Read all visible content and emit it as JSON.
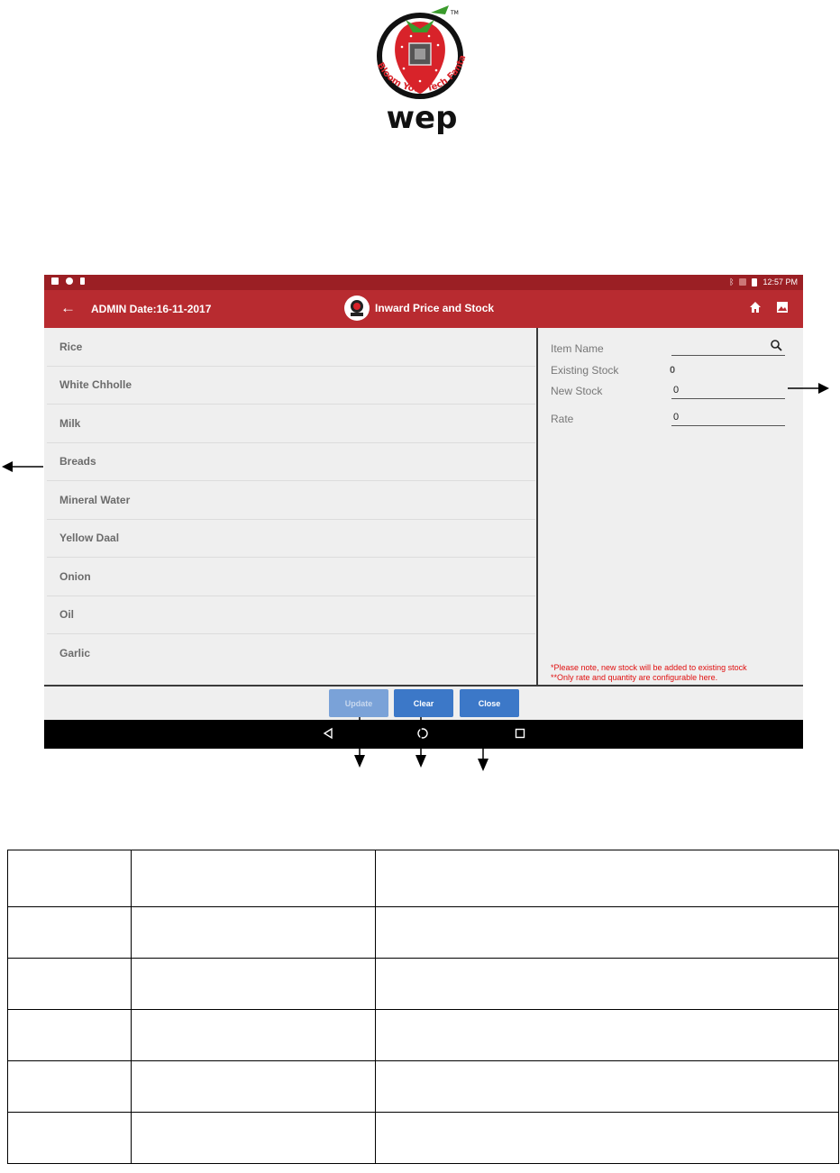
{
  "logo": {
    "trademark": "TM",
    "slogan": "Bloom Your Tech Fantasy",
    "brand": "wep"
  },
  "status_bar": {
    "time": "12:57 PM"
  },
  "app_bar": {
    "user_date": "ADMIN  Date:16-11-2017",
    "title": "Inward Price and Stock"
  },
  "items": [
    "Rice",
    "White Chholle",
    "Milk",
    "Breads",
    "Mineral Water",
    "Yellow Daal",
    "Onion",
    "Oil",
    "Garlic"
  ],
  "form": {
    "item_name_label": "Item Name",
    "item_name_value": "",
    "existing_stock_label": "Existing Stock",
    "existing_stock_value": "0",
    "new_stock_label": "New Stock",
    "new_stock_value": "0",
    "rate_label": "Rate",
    "rate_value": "0",
    "note1": "*Please note, new stock will be added to existing stock",
    "note2": "**Only rate and quantity are configurable here."
  },
  "buttons": {
    "update": "Update",
    "clear": "Clear",
    "close": "Close"
  },
  "colors": {
    "app_bar": "#b82b30",
    "status_bar": "#9b1f24",
    "button": "#3c78c8",
    "note": "#e01010"
  },
  "table": {
    "rows": 6,
    "columns": 3
  }
}
